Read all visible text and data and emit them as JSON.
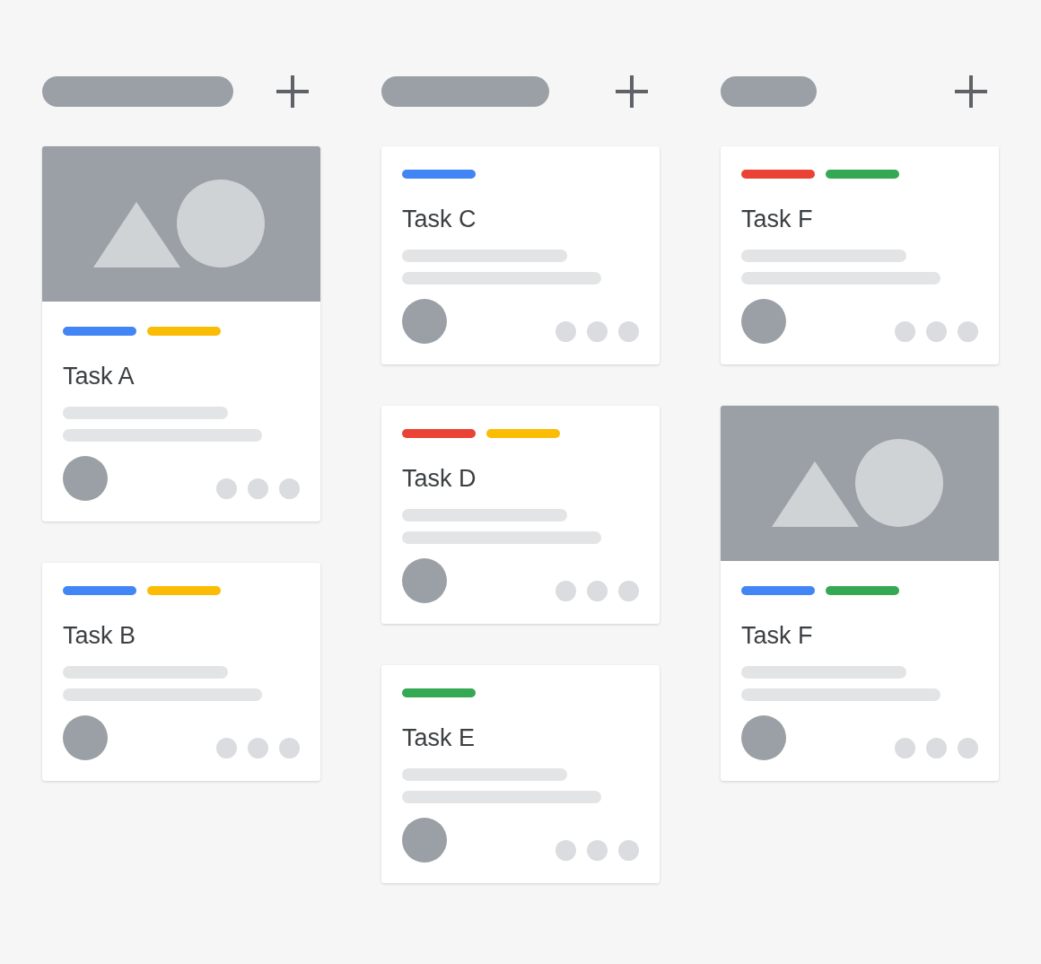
{
  "columns": [
    {
      "cards": [
        {
          "kind": "picture",
          "tags": [
            {
              "color": "#4285f4"
            },
            {
              "color": "#fbbc04"
            }
          ],
          "title": "Task A"
        },
        {
          "kind": "plain",
          "tags": [
            {
              "color": "#4285f4"
            },
            {
              "color": "#fbbc04"
            }
          ],
          "title": "Task B"
        }
      ]
    },
    {
      "cards": [
        {
          "kind": "plain",
          "tags": [
            {
              "color": "#4285f4"
            }
          ],
          "title": "Task C"
        },
        {
          "kind": "plain",
          "tags": [
            {
              "color": "#ea4335"
            },
            {
              "color": "#fbbc04"
            }
          ],
          "title": "Task D"
        },
        {
          "kind": "plain",
          "tags": [
            {
              "color": "#34a853"
            }
          ],
          "title": "Task E"
        }
      ]
    },
    {
      "cards": [
        {
          "kind": "plain",
          "tags": [
            {
              "color": "#ea4335"
            },
            {
              "color": "#34a853"
            }
          ],
          "title": "Task F"
        },
        {
          "kind": "picture",
          "tags": [
            {
              "color": "#4285f4"
            },
            {
              "color": "#34a853"
            }
          ],
          "title": "Task F"
        }
      ]
    }
  ]
}
